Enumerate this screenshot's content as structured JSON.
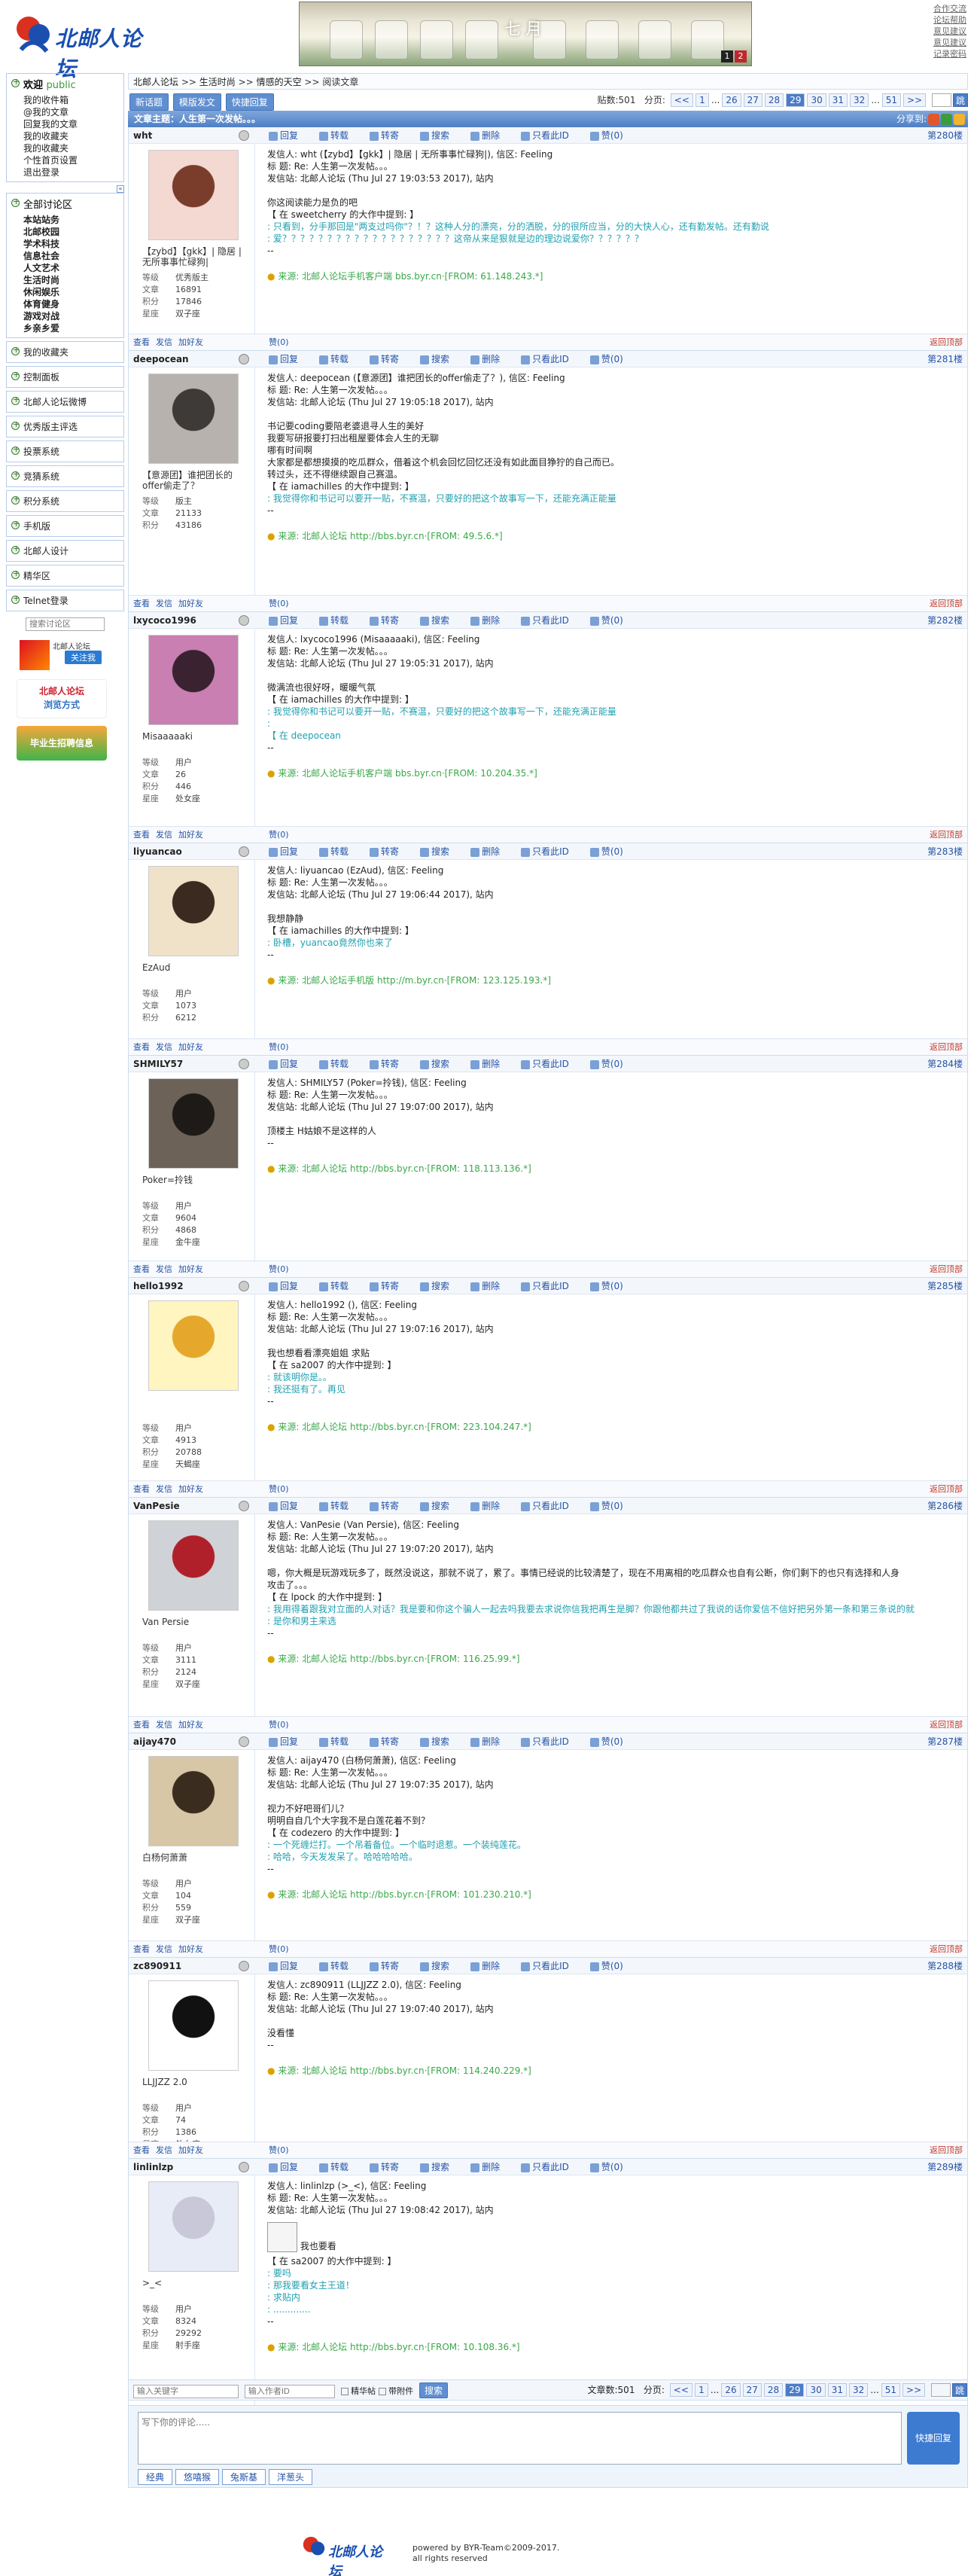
{
  "header": {
    "logo_text": "北邮人论坛",
    "banner_text": "七月",
    "banner_pages": [
      "1",
      "2"
    ],
    "top_links": [
      "合作交流",
      "论坛帮助",
      "意见建议",
      "意见建议",
      "记录密码"
    ]
  },
  "sidebar": {
    "welcome": "欢迎",
    "welcome_user": "public",
    "user_links": [
      "我的收件箱",
      "@我的文章",
      "回复我的文章",
      "我的收藏夹",
      "我的收藏夹",
      "个性首页设置",
      "退出登录"
    ],
    "forum_title": "全部讨论区",
    "forums": [
      "本站站务",
      "北邮校园",
      "学术科技",
      "信息社会",
      "人文艺术",
      "生活时尚",
      "休闲娱乐",
      "体育健身",
      "游戏对战",
      "乡亲乡爱"
    ],
    "collect": "我的收藏夹",
    "control": "控制面板",
    "items": [
      "北邮人论坛微博",
      "优秀版主评选",
      "投票系统",
      "竞猜系统",
      "积分系统",
      "手机版",
      "北邮人设计",
      "精华区",
      "Telnet登录"
    ],
    "search_placeholder": "搜索讨论区",
    "weibo_btn": "关注我",
    "promo1": "北邮人论坛",
    "promo1b": "浏览方式",
    "promo2": "毕业生招聘信息"
  },
  "breadcrumb": [
    "北邮人论坛",
    ">>",
    "生活时尚",
    ">>",
    "情感的天空",
    ">>",
    "阅读文章"
  ],
  "toolbar": {
    "new": "新话题",
    "tpl": "模版发文",
    "quick": "快捷回复",
    "count_label": "贴数:501",
    "page_label": "分页:"
  },
  "pager": [
    "<<",
    "1",
    "...",
    "26",
    "27",
    "28",
    "29",
    "30",
    "31",
    "32",
    "...",
    "51",
    ">>"
  ],
  "pager_current": "29",
  "go": "跳",
  "article_title": "文章主题：人生第一次发帖。。。",
  "share_label": "分享到:",
  "action_labels": {
    "reply": "回复",
    "forward": "转载",
    "repost": "转寄",
    "search": "搜索",
    "del": "删除",
    "only": "只看此ID",
    "like": "赞(0)",
    "view": "查看",
    "mail": "发信",
    "friend": "加好友",
    "top": "返回顶部"
  },
  "labels": {
    "level": "等级",
    "posts": "文章",
    "score": "积分",
    "star": "星座",
    "source": "来源:"
  },
  "posts": [
    {
      "user": "wht",
      "floor": "第280楼",
      "title_text": "【zybd】【gkk】| 隐居 | 无所事事忙碌狗|",
      "stats": [
        "优秀版主",
        "16891",
        "17846",
        "双子座"
      ],
      "lines": [
        "发信人: wht (【zybd】【gkk】| 隐居 | 无所事事忙碌狗|), 信区: Feeling",
        "标  题: Re: 人生第一次发帖。。。",
        "发信站: 北邮人论坛 (Thu Jul 27 19:03:53 2017), 站内",
        "",
        "你这阅读能力是负的吧",
        "【 在 sweetcherry 的大作中提到: 】"
      ],
      "quote": [
        ": 只看到，分手那回是\"两支过吗你\"？！？这种人分的漂亮，分的洒脱，分的很所应当，分的大快人心，还有勤发帖。还有勤说",
        ": 爱？？？？？？？？？？？？？？？？？？？这帝从来是狠就是边的理边说爱你？？？？？？"
      ],
      "after": [
        "--"
      ],
      "source": "来源: 北邮人论坛手机客户端 bbs.byr.cn·[FROM: 61.148.243.*]"
    },
    {
      "user": "deepocean",
      "floor": "第281楼",
      "title_text": "【意源团】谁把团长的offer偷走了？",
      "stats": [
        "版主",
        "21133",
        "43186",
        ""
      ],
      "lines": [
        "发信人: deepocean (【意源团】谁把团长的offer偷走了？), 信区: Feeling",
        "标  题: Re: 人生第一次发帖。。。",
        "发信站: 北邮人论坛 (Thu Jul 27 19:05:18 2017), 站内",
        "",
        "书记要coding要陪老婆退寻人生的美好",
        "我要写研报要打扫出租屋要体会人生的无聊",
        "哪有时间啊",
        "大家都是都想摸摸的吃瓜群众，借着这个机会回忆回忆还没有如此面目狰狞的自己而已。",
        "转过头，还不得继续跟自己赛温。",
        "【 在 iamachilles 的大作中提到: 】"
      ],
      "quote": [
        ": 我觉得你和书记可以要开一贴，不赛温，只要好的把这个故事写一下，还能充满正能量"
      ],
      "after": [
        "--"
      ],
      "source": "来源: 北邮人论坛 http://bbs.byr.cn·[FROM: 49.5.6.*]"
    },
    {
      "user": "lxycoco1996",
      "floor": "第282楼",
      "title_text": "Misaaaaaki",
      "stats": [
        "用户",
        "26",
        "446",
        "处女座"
      ],
      "lines": [
        "发信人: lxycoco1996 (Misaaaaaki), 信区: Feeling",
        "标  题: Re: 人生第一次发帖。。。",
        "发信站: 北邮人论坛 (Thu Jul 27 19:05:31 2017), 站内",
        "",
        "微满流也很好呀，暖暖气氛",
        "【 在 iamachilles 的大作中提到: 】"
      ],
      "quote": [
        ": 我觉得你和书记可以要开一贴，不赛温，只要好的把这个故事写一下，还能充满正能量",
        ": ",
        "【 在 deepocean"
      ],
      "after": [
        "--"
      ],
      "source": "来源: 北邮人论坛手机客户端 bbs.byr.cn·[FROM: 10.204.35.*]"
    },
    {
      "user": "liyuancao",
      "floor": "第283楼",
      "title_text": "EzAud",
      "stats": [
        "用户",
        "1073",
        "6212",
        ""
      ],
      "lines": [
        "发信人: liyuancao (EzAud), 信区: Feeling",
        "标  题: Re: 人生第一次发帖。。。",
        "发信站: 北邮人论坛 (Thu Jul 27 19:06:44 2017), 站内",
        "",
        "我想静静",
        "【 在 iamachilles 的大作中提到: 】"
      ],
      "quote": [
        ": 卧槽，yuancao竟然你也来了"
      ],
      "after": [
        "--"
      ],
      "source": "来源: 北邮人论坛手机版 http://m.byr.cn·[FROM: 123.125.193.*]"
    },
    {
      "user": "SHMILY57",
      "floor": "第284楼",
      "title_text": "Poker=拎钱",
      "stats": [
        "用户",
        "9604",
        "4868",
        "金牛座"
      ],
      "lines": [
        "发信人: SHMILY57 (Poker=拎钱), 信区: Feeling",
        "标  题: Re: 人生第一次发帖。。。",
        "发信站: 北邮人论坛 (Thu Jul 27 19:07:00 2017), 站内",
        "",
        "顶楼主 H姑娘不是这样的人",
        "--"
      ],
      "quote": [],
      "after": [],
      "source": "来源: 北邮人论坛 http://bbs.byr.cn·[FROM: 118.113.136.*]"
    },
    {
      "user": "hello1992",
      "floor": "第285楼",
      "title_text": "",
      "stats": [
        "用户",
        "4913",
        "20788",
        "天蝎座"
      ],
      "lines": [
        "发信人: hello1992 (), 信区: Feeling",
        "标  题: Re: 人生第一次发帖。。。",
        "发信站: 北邮人论坛 (Thu Jul 27 19:07:16 2017), 站内",
        "",
        "我也想看看漂亮姐姐 求贴",
        "【 在 sa2007 的大作中提到: 】"
      ],
      "quote": [
        ": 就该明你是。。",
        ": 我还挺有了。再见"
      ],
      "after": [
        "--"
      ],
      "source": "来源: 北邮人论坛 http://bbs.byr.cn·[FROM: 223.104.247.*]"
    },
    {
      "user": "VanPesie",
      "floor": "第286楼",
      "title_text": "Van Persie",
      "stats": [
        "用户",
        "3111",
        "2124",
        "双子座"
      ],
      "lines": [
        "发信人: VanPesie (Van Persie), 信区: Feeling",
        "标  题: Re: 人生第一次发帖。。。",
        "发信站: 北邮人论坛 (Thu Jul 27 19:07:20 2017), 站内",
        "",
        "嗯，你大概是玩游戏玩多了，既然没说这，那就不说了，累了。事情已经说的比较清楚了，现在不用离相的吃瓜群众也自有公断，你们剩下的也只有选择和人身",
        "攻击了。。。",
        "【 在 lpock 的大作中提到: 】"
      ],
      "quote": [
        ": 我用得着跟我对立面的人对话？我是要和你这个骗人一起去吗我要去求说你信我把再生是脚？你跟他都共过了我说的话你爱信不信好把另外第一条和第三条说的就",
        ": 是你和男主来选"
      ],
      "after": [
        "--"
      ],
      "source": "来源: 北邮人论坛 http://bbs.byr.cn·[FROM: 116.25.99.*]"
    },
    {
      "user": "aijay470",
      "floor": "第287楼",
      "title_text": "白杨何萧萧",
      "stats": [
        "用户",
        "104",
        "559",
        "双子座"
      ],
      "lines": [
        "发信人: aijay470 (白杨何萧萧), 信区: Feeling",
        "标  题: Re: 人生第一次发帖。。。",
        "发信站: 北邮人论坛 (Thu Jul 27 19:07:35 2017), 站内",
        "",
        "视力不好吧哥们儿？",
        "明明自自几个大字我不是白莲花着不到？",
        "【 在 codezero 的大作中提到: 】"
      ],
      "quote": [
        ": 一个死缠烂打。一个吊着备位。一个临时退惹。一个装纯莲花。",
        ": 哈哈，今天发发呆了。哈哈哈哈哈。"
      ],
      "after": [
        "--"
      ],
      "source": "来源: 北邮人论坛 http://bbs.byr.cn·[FROM: 101.230.210.*]"
    },
    {
      "user": "zc890911",
      "floor": "第288楼",
      "title_text": "LLJJZZ 2.0",
      "stats": [
        "用户",
        "74",
        "1386",
        "处女座"
      ],
      "lines": [
        "发信人: zc890911 (LLJJZZ 2.0), 信区: Feeling",
        "标  题: Re: 人生第一次发帖。。。",
        "发信站: 北邮人论坛 (Thu Jul 27 19:07:40 2017), 站内",
        "",
        "没看懂",
        "--"
      ],
      "quote": [],
      "after": [],
      "source": "来源: 北邮人论坛 http://bbs.byr.cn·[FROM: 114.240.229.*]"
    },
    {
      "user": "linlinlzp",
      "floor": "第289楼",
      "title_text": ">_<",
      "stats": [
        "用户",
        "8324",
        "29292",
        "射手座"
      ],
      "lines": [
        "发信人: linlinlzp (>_<), 信区: Feeling",
        "标  题: Re: 人生第一次发帖。。。",
        "发信站: 北邮人论坛 (Thu Jul 27 19:08:42 2017), 站内"
      ],
      "emoji_text": "我也要看",
      "lines2": [
        "【 在 sa2007 的大作中提到: 】"
      ],
      "quote": [
        ": 要吗",
        ": 那我要看女主王道！",
        ": 求贴内",
        ": ............."
      ],
      "after": [
        "--"
      ],
      "source": "来源: 北邮人论坛 http://bbs.byr.cn·[FROM: 10.108.36.*]"
    }
  ],
  "bottom": {
    "kw_placeholder": "输入关键字",
    "author_placeholder": "输入作者ID",
    "chk1": "精华帖",
    "chk2": "带附件",
    "search": "搜索",
    "count_label": "文章数:501",
    "page_label": "分页:"
  },
  "reply": {
    "placeholder": "写下你的评论.....",
    "quick": "快捷回复",
    "emotions": [
      "经典",
      "悠嘻猴",
      "兔斯基",
      "洋葱头"
    ]
  },
  "footer": {
    "line1": "powered by BYR-Team©2009-2017.",
    "line2": "all rights reserved"
  }
}
